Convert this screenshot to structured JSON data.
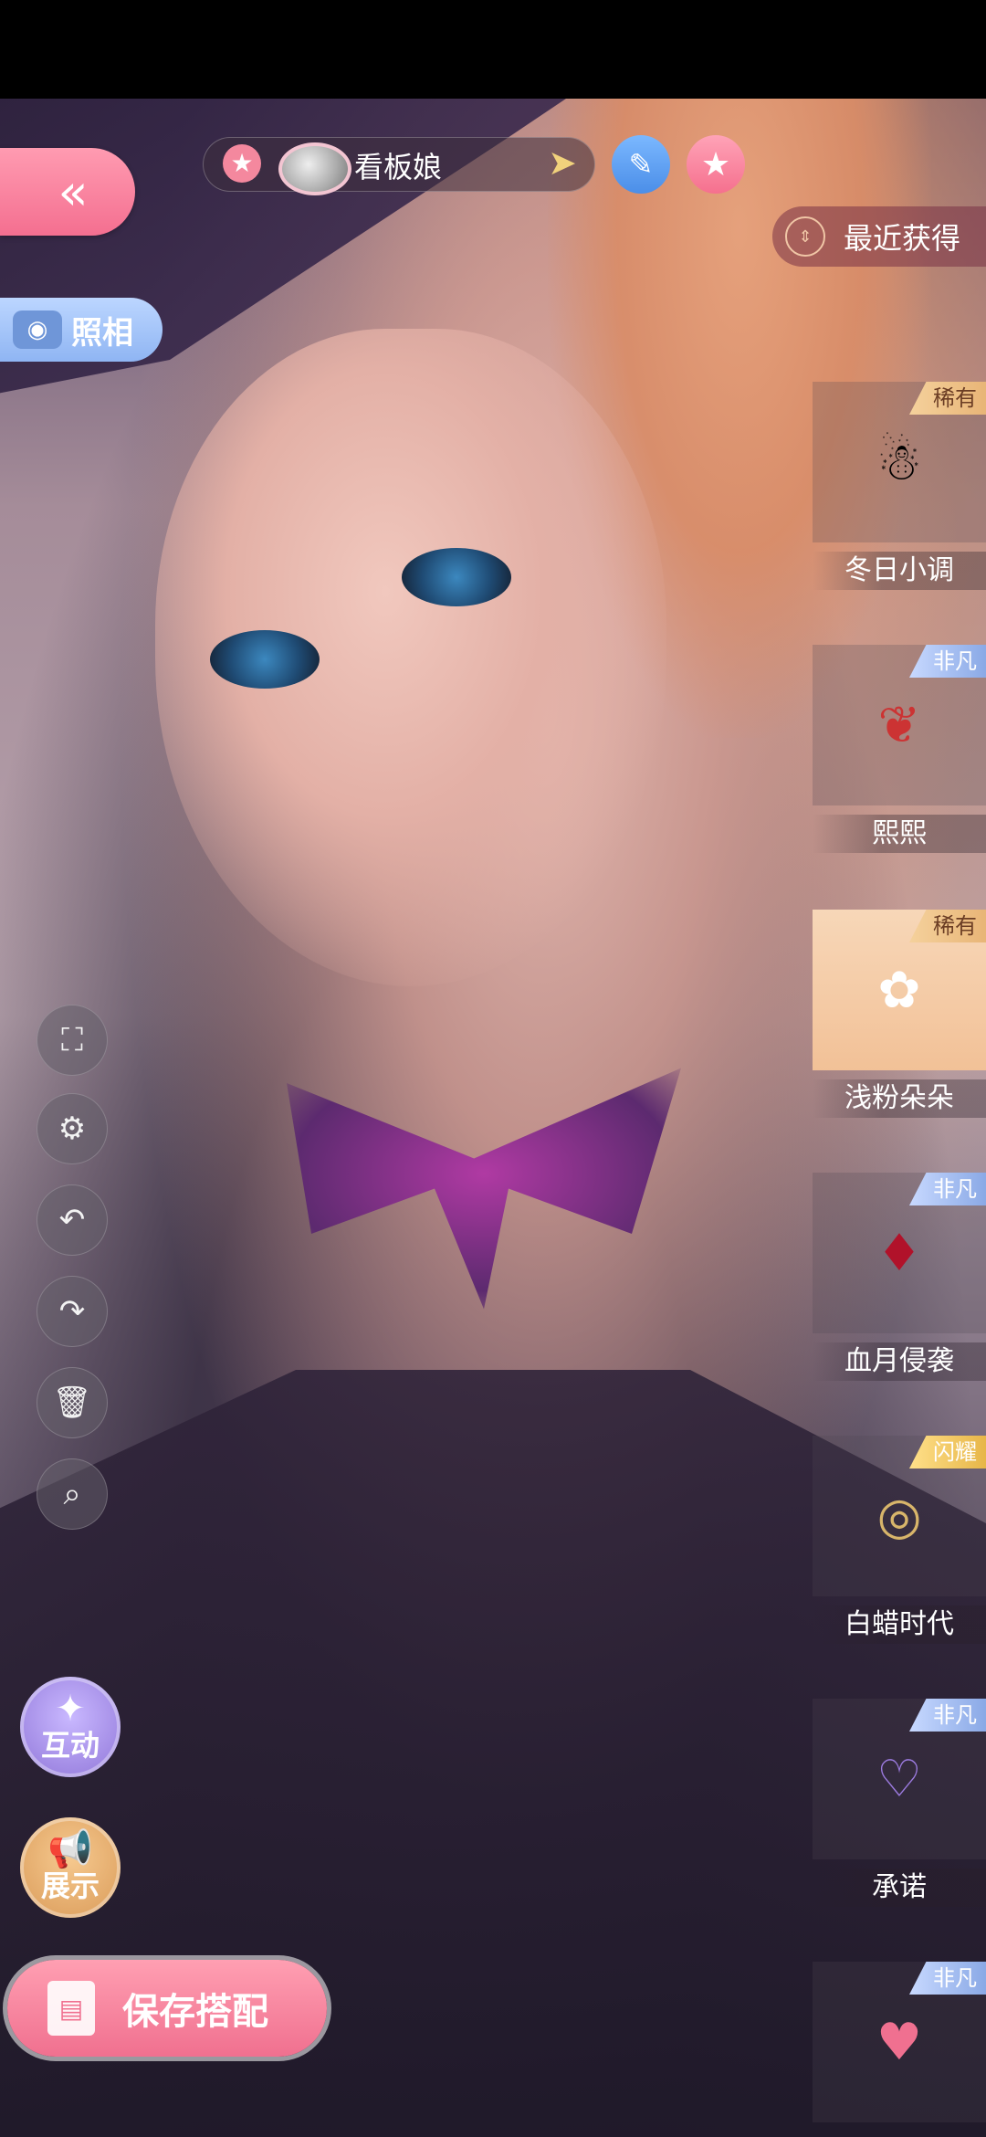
{
  "top_bar": {
    "back_icon": "double-chevron-left-icon",
    "character_name": "看板娘",
    "name_arrow": "➤",
    "edit_icon": "pencil-icon",
    "favorite_icon": "star-icon"
  },
  "sort": {
    "label": "最近获得",
    "icon": "sort-updown-icon"
  },
  "photo": {
    "label": "照相",
    "icon": "camera-icon"
  },
  "tools": [
    {
      "name": "fullscreen",
      "glyph": "⛶"
    },
    {
      "name": "settings",
      "glyph": "⚙"
    },
    {
      "name": "undo",
      "glyph": "↶"
    },
    {
      "name": "redo",
      "glyph": "↷"
    },
    {
      "name": "delete",
      "glyph": "🗑"
    },
    {
      "name": "zoom",
      "glyph": "⌕"
    }
  ],
  "actions": {
    "interact_label": "互动",
    "showcase_label": "展示",
    "save_label": "保存搭配"
  },
  "items": [
    {
      "name": "冬日小调",
      "rarity": "稀有",
      "rarity_kind": "rare",
      "icon": "snowman-earrings-icon",
      "glyph": "☃",
      "selected": false
    },
    {
      "name": "熙熙",
      "rarity": "非凡",
      "rarity_kind": "super",
      "icon": "berry-earrings-icon",
      "glyph": "❦",
      "selected": false
    },
    {
      "name": "浅粉朵朵",
      "rarity": "稀有",
      "rarity_kind": "rare",
      "icon": "flower-earrings-icon",
      "glyph": "✿",
      "selected": true
    },
    {
      "name": "血月侵袭",
      "rarity": "非凡",
      "rarity_kind": "super",
      "icon": "blood-moon-earrings-icon",
      "glyph": "♦",
      "selected": false
    },
    {
      "name": "白蜡时代",
      "rarity": "闪耀",
      "rarity_kind": "glow",
      "icon": "hoop-earrings-icon",
      "glyph": "◎",
      "selected": false
    },
    {
      "name": "承诺",
      "rarity": "非凡",
      "rarity_kind": "super",
      "icon": "heart-earrings-icon",
      "glyph": "♡",
      "selected": false
    },
    {
      "name": "",
      "rarity": "非凡",
      "rarity_kind": "super",
      "icon": "pink-heart-earrings-icon",
      "glyph": "♥",
      "selected": false
    }
  ]
}
